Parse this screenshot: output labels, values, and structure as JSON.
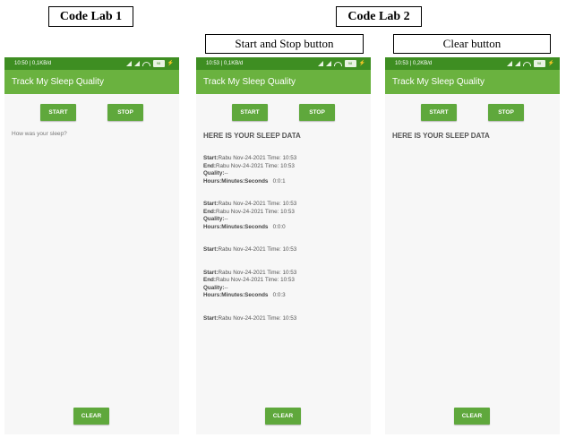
{
  "labels": {
    "code_lab_1": "Code Lab 1",
    "code_lab_2": "Code Lab 2",
    "start_stop_caption": "Start and Stop button",
    "clear_caption": "Clear button"
  },
  "colors": {
    "status_bar": "#3e8e22",
    "app_bar": "#6ab23f",
    "button": "#5fa83c",
    "background": "#f7f7f7"
  },
  "screens": [
    {
      "status_left": "10:50 | 0,1KB/d",
      "battery": "98"
    },
    {
      "status_left": "10:53 | 0,1KB/d",
      "battery": "98"
    },
    {
      "status_left": "10:53 | 0,2KB/d",
      "battery": "98"
    }
  ],
  "app": {
    "title": "Track My Sleep Quality",
    "start_label": "START",
    "stop_label": "STOP",
    "clear_label": "CLEAR",
    "prompt": "How was your sleep?",
    "heading": "HERE IS YOUR SLEEP DATA"
  },
  "fields": {
    "start": "Start:",
    "end": "End:",
    "quality": "Quality:",
    "hms": "Hours:Minutes:Seconds"
  },
  "records": [
    {
      "start": "Rabu Nov-24-2021 Time: 10:53",
      "end": "Rabu Nov-24-2021 Time: 10:53",
      "quality": "--",
      "duration": "0:0:1"
    },
    {
      "start": "Rabu Nov-24-2021 Time: 10:53",
      "end": "Rabu Nov-24-2021 Time: 10:53",
      "quality": "--",
      "duration": "0:0:0"
    },
    {
      "start": "Rabu Nov-24-2021 Time: 10:53"
    },
    {
      "start": "Rabu Nov-24-2021 Time: 10:53",
      "end": "Rabu Nov-24-2021 Time: 10:53",
      "quality": "--",
      "duration": "0:0:3"
    },
    {
      "start": "Rabu Nov-24-2021 Time: 10:53"
    }
  ]
}
